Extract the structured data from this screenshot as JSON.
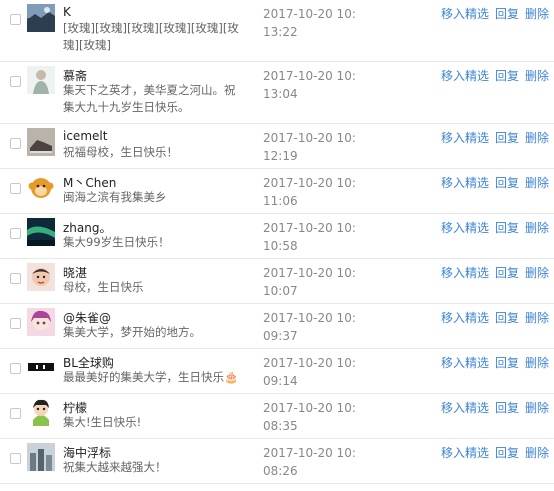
{
  "actions": {
    "feature": "移入精选",
    "reply": "回复",
    "delete": "删除"
  },
  "comments": [
    {
      "name": "K",
      "message": "[玫瑰][玫瑰][玫瑰][玫瑰][玫瑰][玫瑰][玫瑰]",
      "time": "2017-10-20 10:13:22",
      "avatar": "landscape-avatar-icon"
    },
    {
      "name": "慕斋",
      "message": "集天下之英才，美华夏之河山。祝集大九十九岁生日快乐。",
      "time": "2017-10-20 10:13:04",
      "avatar": "figure-avatar-icon"
    },
    {
      "name": "icemelt",
      "message": "祝福母校，生日快乐！",
      "time": "2017-10-20 10:12:19",
      "avatar": "shoes-avatar-icon"
    },
    {
      "name": "M丶Chen",
      "message": "闽海之滨有我集美乡",
      "time": "2017-10-20 10:11:06",
      "avatar": "monkey-avatar-icon"
    },
    {
      "name": "zhang。",
      "message": "集大99岁生日快乐！",
      "time": "2017-10-20 10:10:58",
      "avatar": "aurora-avatar-icon"
    },
    {
      "name": "晓湛",
      "message": "母校，生日快乐",
      "time": "2017-10-20 10:10:07",
      "avatar": "baby-avatar-icon"
    },
    {
      "name": "@朱雀@",
      "message": "集美大学，梦开始的地方。",
      "time": "2017-10-20 10:09:37",
      "avatar": "anime-avatar-icon"
    },
    {
      "name": "BL全球购",
      "message": "最最美好的集美大学，生日快乐🎂",
      "time": "2017-10-20 10:09:14",
      "avatar": "logo-avatar-icon"
    },
    {
      "name": "柠檬",
      "message": "集大!生日快乐!",
      "time": "2017-10-20 10:08:35",
      "avatar": "cartoon-avatar-icon"
    },
    {
      "name": "海中浮标",
      "message": "祝集大越来越强大！",
      "time": "2017-10-20 10:08:26",
      "avatar": "city-avatar-icon"
    }
  ]
}
